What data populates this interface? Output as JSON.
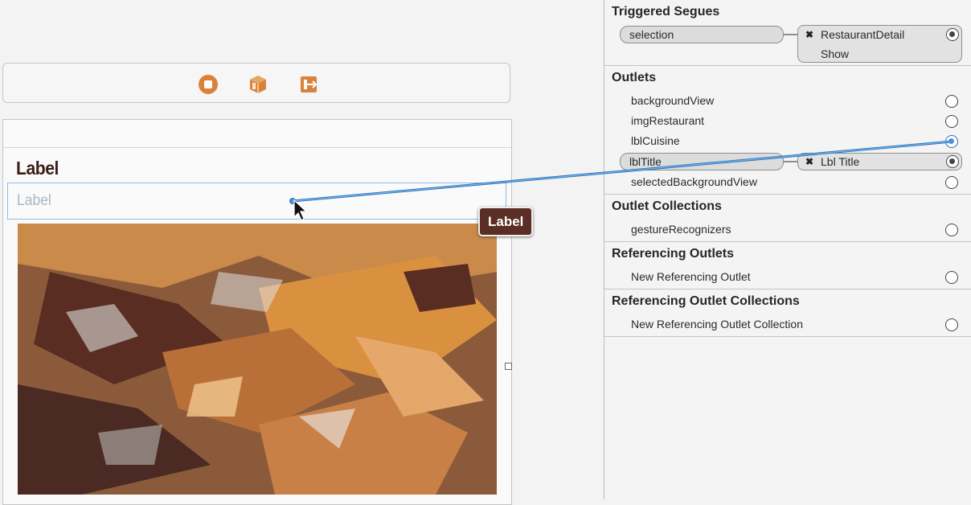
{
  "canvas": {
    "title_label": "Label",
    "cuisine_label": "Label",
    "tooltip": "Label",
    "icons": [
      "first-responder-icon",
      "object-cube-icon",
      "exit-icon"
    ],
    "accent_color": "#d9833a"
  },
  "connections": {
    "triggered_segues": {
      "title": "Triggered Segues",
      "items": [
        {
          "name": "selection",
          "destination": "RestaurantDetail",
          "kind": "Show"
        }
      ]
    },
    "outlets": {
      "title": "Outlets",
      "items": [
        {
          "name": "backgroundView"
        },
        {
          "name": "imgRestaurant"
        },
        {
          "name": "lblCuisine"
        },
        {
          "name": "lblTitle",
          "connected_to": "Lbl Title"
        },
        {
          "name": "selectedBackgroundView"
        }
      ]
    },
    "outlet_collections": {
      "title": "Outlet Collections",
      "items": [
        {
          "name": "gestureRecognizers"
        }
      ]
    },
    "referencing_outlets": {
      "title": "Referencing Outlets",
      "items": [
        {
          "name": "New Referencing Outlet"
        }
      ]
    },
    "referencing_outlet_collections": {
      "title": "Referencing Outlet Collections",
      "items": [
        {
          "name": "New Referencing Outlet Collection"
        }
      ]
    }
  }
}
